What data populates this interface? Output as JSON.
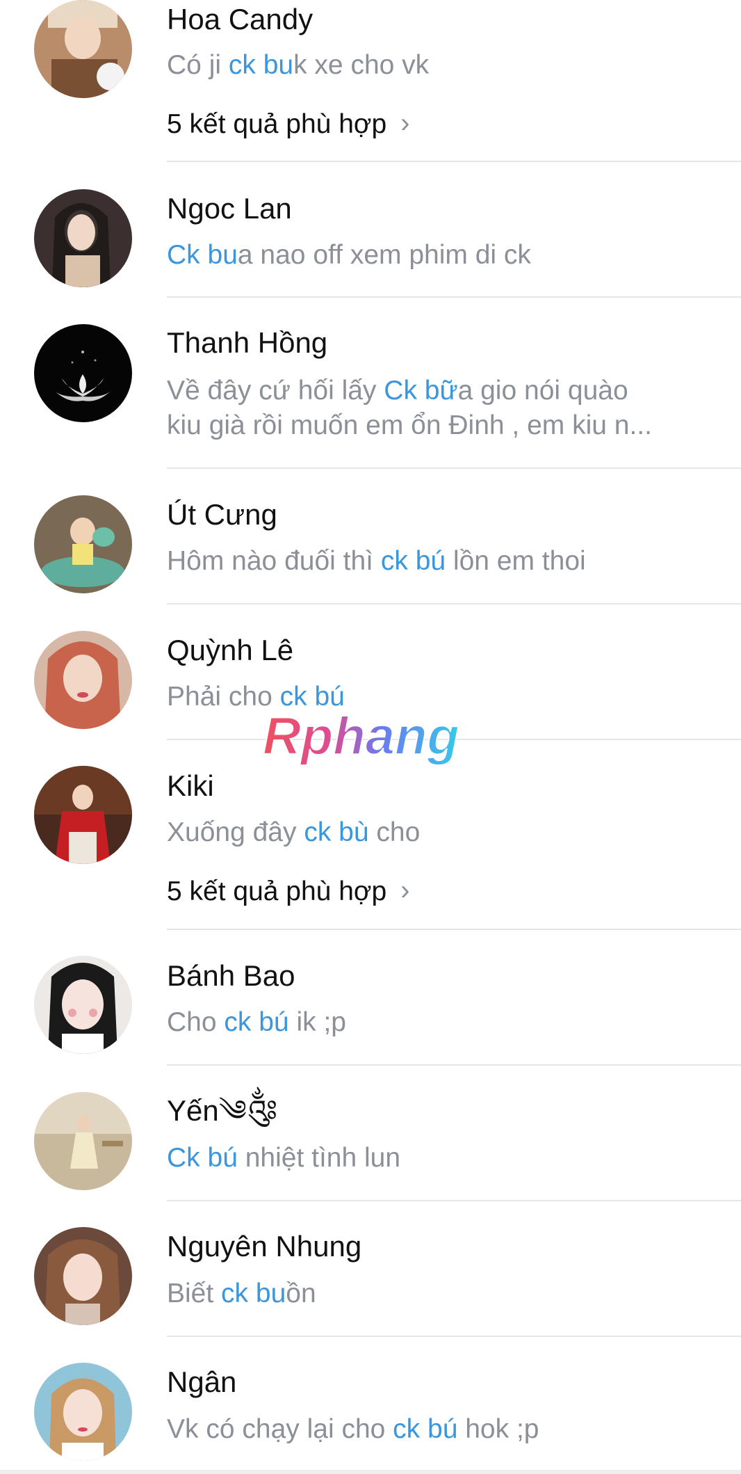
{
  "results": [
    {
      "name": "Hoa Candy",
      "snippet_lines": [
        [
          {
            "t": "Có ji ",
            "hl": false
          },
          {
            "t": "ck bu",
            "hl": true
          },
          {
            "t": "k xe cho vk",
            "hl": false
          }
        ]
      ],
      "more": {
        "count": "5",
        "label": " kết quả phù hợp"
      }
    },
    {
      "name": "Ngoc Lan",
      "snippet_lines": [
        [
          {
            "t": "Ck bu",
            "hl": true
          },
          {
            "t": "a nao off xem phim di ck",
            "hl": false
          }
        ]
      ],
      "more": null
    },
    {
      "name": "Thanh Hồng",
      "snippet_lines": [
        [
          {
            "t": "Về đây cứ hối lấy ",
            "hl": false
          },
          {
            "t": "Ck bữ",
            "hl": true
          },
          {
            "t": "a gio nói quào",
            "hl": false
          }
        ],
        [
          {
            "t": "kiu già rồi muốn em ổn Đinh , em kiu n...",
            "hl": false
          }
        ]
      ],
      "more": null
    },
    {
      "name": "Út Cưng",
      "snippet_lines": [
        [
          {
            "t": "Hôm nào đuối thì ",
            "hl": false
          },
          {
            "t": "ck bú",
            "hl": true
          },
          {
            "t": " lồn em thoi",
            "hl": false
          }
        ]
      ],
      "more": null
    },
    {
      "name": "Quỳnh Lê",
      "snippet_lines": [
        [
          {
            "t": "Phải cho ",
            "hl": false
          },
          {
            "t": "ck bú",
            "hl": true
          }
        ]
      ],
      "more": null
    },
    {
      "name": "Kiki",
      "snippet_lines": [
        [
          {
            "t": "Xuống đây ",
            "hl": false
          },
          {
            "t": "ck bù",
            "hl": true
          },
          {
            "t": " cho",
            "hl": false
          }
        ]
      ],
      "more": {
        "count": "5",
        "label": " kết quả phù hợp"
      }
    },
    {
      "name": "Bánh Bao",
      "snippet_lines": [
        [
          {
            "t": "Cho ",
            "hl": false
          },
          {
            "t": "ck bú",
            "hl": true
          },
          {
            "t": " ik ;p",
            "hl": false
          }
        ]
      ],
      "more": null
    },
    {
      "name": "Yến༄༂",
      "snippet_lines": [
        [
          {
            "t": "Ck bú",
            "hl": true
          },
          {
            "t": " nhiệt tình lun",
            "hl": false
          }
        ]
      ],
      "more": null
    },
    {
      "name": "Nguyên Nhung",
      "snippet_lines": [
        [
          {
            "t": "Biết ",
            "hl": false
          },
          {
            "t": "ck bu",
            "hl": true
          },
          {
            "t": "ồn",
            "hl": false
          }
        ]
      ],
      "more": null
    },
    {
      "name": "Ngân",
      "snippet_lines": [
        [
          {
            "t": "Vk có chạy lại cho ",
            "hl": false
          },
          {
            "t": "ck bú",
            "hl": true
          },
          {
            "t": " hok ;p",
            "hl": false
          }
        ]
      ],
      "more": null
    }
  ],
  "watermark": {
    "text": "Rphang"
  },
  "colors": {
    "highlight": "#3a96dd",
    "snippet": "#8a8f98",
    "name": "#111111",
    "separator": "#e4e6ea"
  }
}
